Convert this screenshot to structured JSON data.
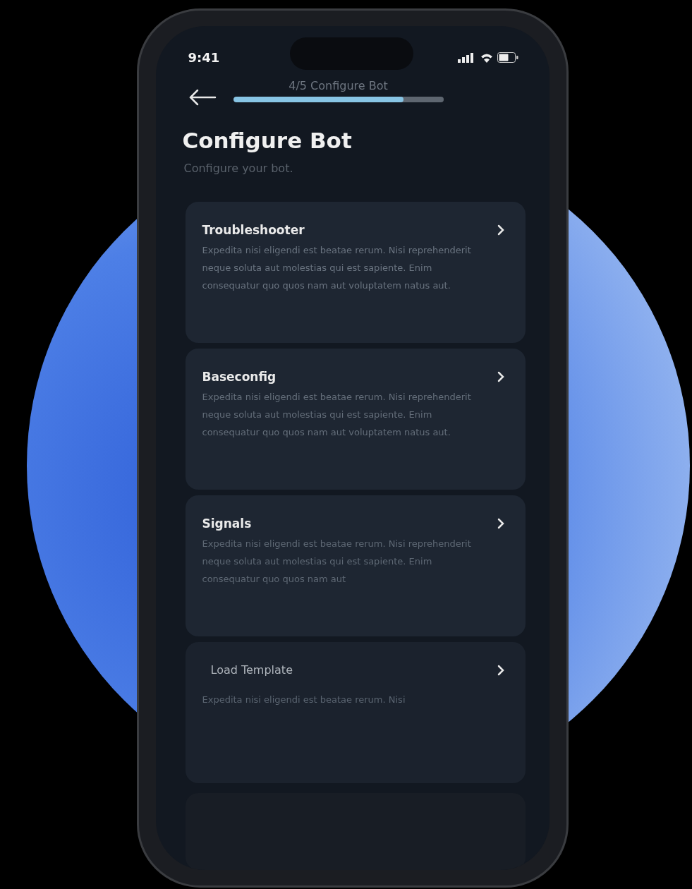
{
  "status_bar": {
    "time": "9:41"
  },
  "header": {
    "progress_label": "4/5 Configure Bot",
    "progress": {
      "level": 0.81
    }
  },
  "title": "Configure Bot",
  "subtitle": "Configure your bot.",
  "cards": [
    {
      "title": "Troubleshooter",
      "description": "Expedita nisi eligendi est beatae rerum. Nisi reprehenderit neque soluta aut molestias qui est sapiente. Enim consequatur quo quos nam aut voluptatem natus aut."
    },
    {
      "title": "Baseconfig",
      "description": "Expedita nisi eligendi est beatae rerum. Nisi reprehenderit neque soluta aut molestias qui est sapiente. Enim consequatur quo quos nam aut voluptatem natus aut."
    },
    {
      "title": "Signals",
      "description": "Expedita nisi eligendi est beatae rerum. Nisi reprehenderit neque soluta aut molestias qui est sapiente. Enim consequatur quo quos nam aut"
    },
    {
      "title": "Load Template",
      "description": "Expedita nisi eligendi est beatae rerum. Nisi"
    }
  ]
}
